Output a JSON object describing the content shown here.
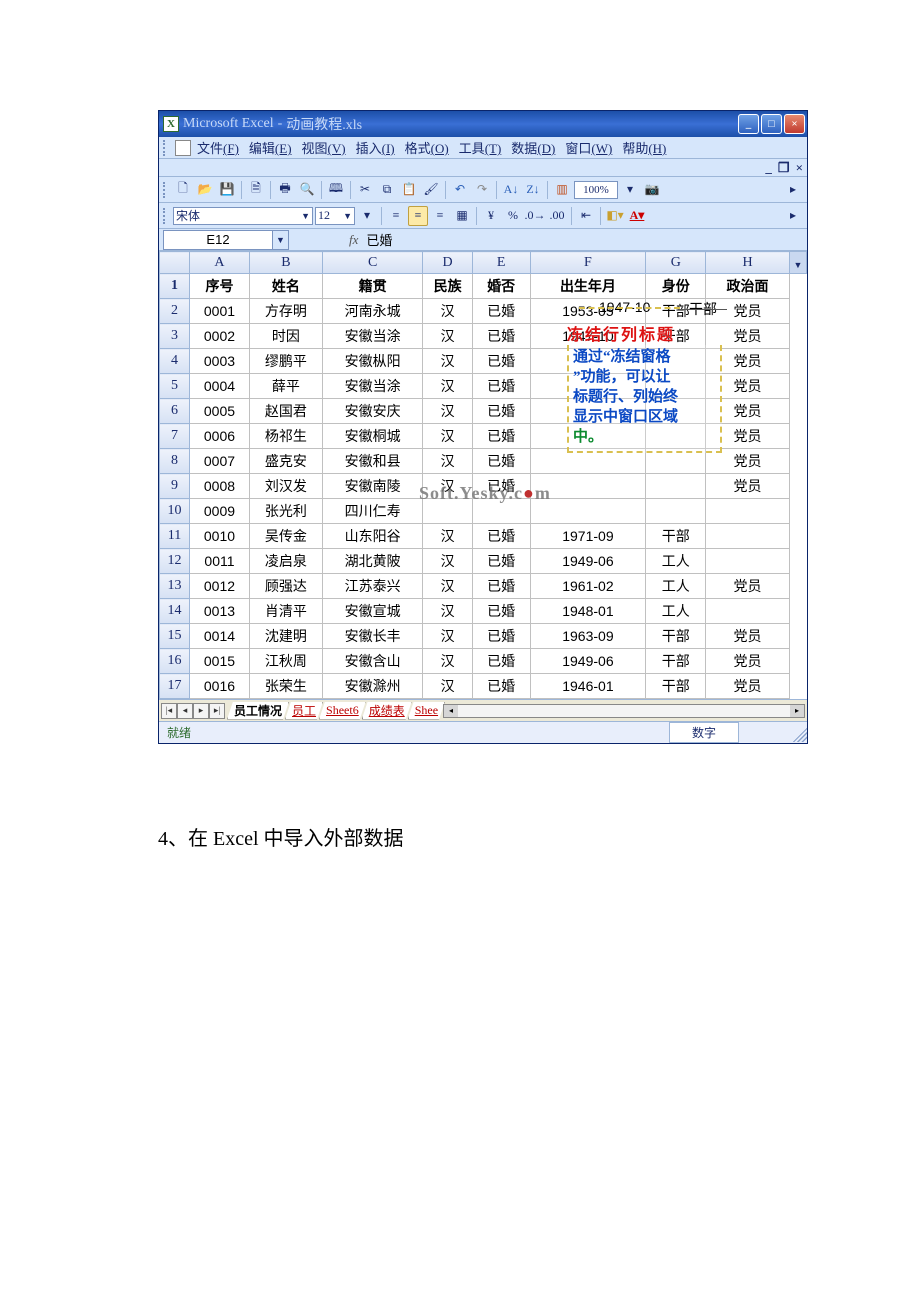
{
  "title": {
    "app_ms": "Microsoft Excel",
    "sep": " - ",
    "file": "动画教程.xls"
  },
  "menu": {
    "file": "文件",
    "file_hk": "(F)",
    "edit": "编辑",
    "edit_hk": "(E)",
    "view": "视图",
    "view_hk": "(V)",
    "insert": "插入",
    "insert_hk": "(I)",
    "format": "格式",
    "format_hk": "(O)",
    "tools": "工具",
    "tools_hk": "(T)",
    "data": "数据",
    "data_hk": "(D)",
    "window": "窗口",
    "window_hk": "(W)",
    "help": "帮助",
    "help_hk": "(H)"
  },
  "toolbar": {
    "zoom": "100%"
  },
  "format": {
    "font": "宋体",
    "size": "12"
  },
  "formula": {
    "cellref": "E12",
    "fx": "fx",
    "value": "已婚"
  },
  "columns": [
    "A",
    "B",
    "C",
    "D",
    "E",
    "F",
    "G",
    "H"
  ],
  "header_row": {
    "A": "序号",
    "B": "姓名",
    "C": "籍贯",
    "D": "民族",
    "E": "婚否",
    "F": "出生年月",
    "G": "身份",
    "H": "政治面"
  },
  "rows": [
    {
      "n": "1"
    },
    {
      "n": "2",
      "A": "0001",
      "B": "方存明",
      "C": "河南永城",
      "D": "汉",
      "E": "已婚",
      "F": "1953-05",
      "G": "干部",
      "H": "党员"
    },
    {
      "n": "3",
      "A": "0002",
      "B": "时因",
      "C": "安徽当涂",
      "D": "汉",
      "E": "已婚",
      "F": "1947-10",
      "G": "干部",
      "H": "党员"
    },
    {
      "n": "4",
      "A": "0003",
      "B": "缪鹏平",
      "C": "安徽枞阳",
      "D": "汉",
      "E": "已婚",
      "F": "",
      "G": "",
      "H": "党员"
    },
    {
      "n": "5",
      "A": "0004",
      "B": "薛平",
      "C": "安徽当涂",
      "D": "汉",
      "E": "已婚",
      "F": "",
      "G": "",
      "H": "党员"
    },
    {
      "n": "6",
      "A": "0005",
      "B": "赵国君",
      "C": "安徽安庆",
      "D": "汉",
      "E": "已婚",
      "F": "",
      "G": "",
      "H": "党员"
    },
    {
      "n": "7",
      "A": "0006",
      "B": "杨祁生",
      "C": "安徽桐城",
      "D": "汉",
      "E": "已婚",
      "F": "",
      "G": "",
      "H": "党员"
    },
    {
      "n": "8",
      "A": "0007",
      "B": "盛克安",
      "C": "安徽和县",
      "D": "汉",
      "E": "已婚",
      "F": "",
      "G": "",
      "H": "党员"
    },
    {
      "n": "9",
      "A": "0008",
      "B": "刘汉发",
      "C": "安徽南陵",
      "D": "汉",
      "E": "已婚",
      "F": "",
      "G": "",
      "H": "党员"
    },
    {
      "n": "10",
      "A": "0009",
      "B": "张光利",
      "C": "四川仁寿",
      "D": "",
      "E": "",
      "F": "",
      "G": "",
      "H": ""
    },
    {
      "n": "11",
      "A": "0010",
      "B": "吴传金",
      "C": "山东阳谷",
      "D": "汉",
      "E": "已婚",
      "F": "1971-09",
      "G": "干部",
      "H": ""
    },
    {
      "n": "12",
      "A": "0011",
      "B": "凌启泉",
      "C": "湖北黄陂",
      "D": "汉",
      "E": "已婚",
      "F": "1949-06",
      "G": "工人",
      "H": ""
    },
    {
      "n": "13",
      "A": "0012",
      "B": "顾强达",
      "C": "江苏泰兴",
      "D": "汉",
      "E": "已婚",
      "F": "1961-02",
      "G": "工人",
      "H": "党员"
    },
    {
      "n": "14",
      "A": "0013",
      "B": "肖清平",
      "C": "安徽宣城",
      "D": "汉",
      "E": "已婚",
      "F": "1948-01",
      "G": "工人",
      "H": ""
    },
    {
      "n": "15",
      "A": "0014",
      "B": "沈建明",
      "C": "安徽长丰",
      "D": "汉",
      "E": "已婚",
      "F": "1963-09",
      "G": "干部",
      "H": "党员"
    },
    {
      "n": "16",
      "A": "0015",
      "B": "江秋周",
      "C": "安徽含山",
      "D": "汉",
      "E": "已婚",
      "F": "1949-06",
      "G": "干部",
      "H": "党员"
    },
    {
      "n": "17",
      "A": "0016",
      "B": "张荣生",
      "C": "安徽滁州",
      "D": "汉",
      "E": "已婚",
      "F": "1946-01",
      "G": "干部",
      "H": "党员"
    }
  ],
  "annotation": {
    "freeze_title": "冻结行列标题",
    "line1": "通过“冻结窗格",
    "line2": "”功能，可以让",
    "line3": "标题行、列始终",
    "line4": "显示中窗口区域",
    "line5": "中。",
    "hidden_f": "1947-10",
    "hidden_g": "干部"
  },
  "watermark": "Soft.Yesky.c●m",
  "tabs": {
    "t1": "员工情况",
    "t2": "员工",
    "t3": "Sheet6",
    "t4": "成绩表",
    "t5": "Shee"
  },
  "status": {
    "ready": "就绪",
    "numlock": "数字"
  },
  "doc_text": "4、在 Excel 中导入外部数据"
}
